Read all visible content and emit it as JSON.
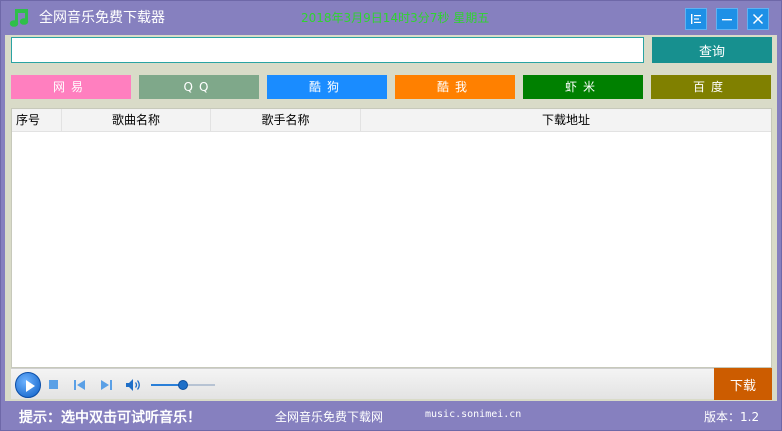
{
  "window": {
    "title": "全网音乐免费下载器",
    "datetime": "2018年3月9日14时3分7秒",
    "weekday": "星期五",
    "icon": "music-note-icon",
    "controls": [
      "menu-icon",
      "minimize-icon",
      "close-icon"
    ]
  },
  "search": {
    "value": "",
    "query_label": "查询"
  },
  "sources": [
    {
      "label": "网易",
      "color": "#ff7fbf"
    },
    {
      "label": "QQ",
      "color": "#7fa88a"
    },
    {
      "label": "酷狗",
      "color": "#1a8cff"
    },
    {
      "label": "酷我",
      "color": "#ff8000"
    },
    {
      "label": "虾米",
      "color": "#008000"
    },
    {
      "label": "百度",
      "color": "#808000"
    }
  ],
  "table": {
    "columns": [
      "序号",
      "歌曲名称",
      "歌手名称",
      "下载地址"
    ],
    "rows": []
  },
  "player": {
    "volume": 0.5
  },
  "download_label": "下载",
  "statusbar": {
    "tip": "提示：选中双击可试听音乐！",
    "site_name": "全网音乐免费下载网",
    "site_url": "music.sonimei.cn",
    "version": "版本：1.2"
  },
  "colors": {
    "titlebar": "#8680bf",
    "panel": "#d9dbc8",
    "query_button": "#17908f",
    "download_button": "#cc5c00",
    "datetime_text": "#2fd42f"
  }
}
